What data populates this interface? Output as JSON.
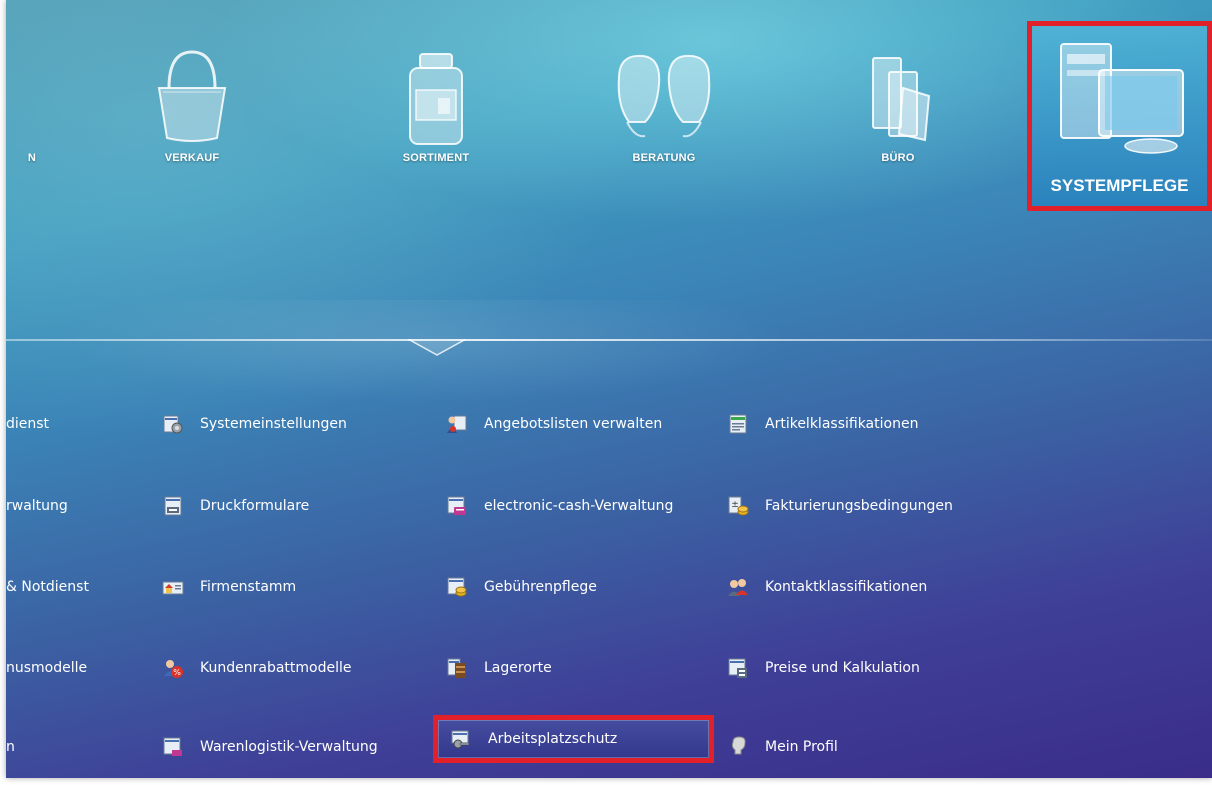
{
  "top_nav": {
    "partial_label": "N",
    "tiles": [
      {
        "label": "VERKAUF",
        "icon": "shopping-bag-icon"
      },
      {
        "label": "SORTIMENT",
        "icon": "medicine-jar-icon"
      },
      {
        "label": "BERATUNG",
        "icon": "consultation-heads-icon"
      },
      {
        "label": "BÜRO",
        "icon": "office-binders-icon"
      },
      {
        "label": "SYSTEMPFLEGE",
        "icon": "computer-monitor-icon",
        "selected": true
      }
    ]
  },
  "menu": {
    "col0": [
      "dienst",
      "rwaltung",
      "& Notdienst",
      "nusmodelle",
      "n"
    ],
    "col1": [
      "Systemeinstellungen",
      "Druckformulare",
      "Firmenstamm",
      "Kundenrabattmodelle",
      "Warenlogistik-Verwaltung"
    ],
    "col2": [
      "Angebotslisten verwalten",
      "electronic-cash-Verwaltung",
      "Gebührenpflege",
      "Lagerorte",
      "Arbeitsplatzschutz"
    ],
    "col3": [
      "Artikelklassifikationen",
      "Fakturierungsbedingungen",
      "Kontaktklassifikationen",
      "Preise und Kalkulation",
      "Mein Profil"
    ],
    "selected_item": "Arbeitsplatzschutz"
  },
  "colors": {
    "highlight_border": "#e1202a",
    "bg_top": "#4f9db3",
    "bg_bottom": "#3a2d8a"
  }
}
